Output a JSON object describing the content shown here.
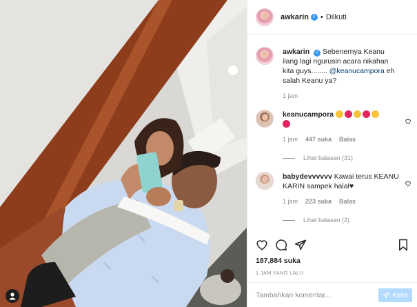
{
  "header": {
    "username": "awkarin",
    "separator": "•",
    "follow_status": "Diikuti"
  },
  "caption": {
    "username": "awkarin",
    "text_before_mention": "Sebenernya Keanu ilang lagi ngurusin acara nikahan kita guys........",
    "mention": "@keanucampora",
    "text_after_mention": "eh salah Keanu ya?",
    "time": "1 jam"
  },
  "comments": [
    {
      "username": "keanucampora",
      "emojis": [
        "grinning-emoji",
        "heart-emoji",
        "grinning-emoji",
        "heart-emoji",
        "grinning-emoji",
        "heart-emoji"
      ],
      "time": "1 jam",
      "likes": "447 suka",
      "reply_label": "Balas",
      "view_replies": "Lihat balasan (31)"
    },
    {
      "username": "babydevvvvvv",
      "text": "Kawai terus KEANU KARIN sampek halal",
      "heart_glyph": "♥",
      "time": "1 jam",
      "likes": "223 suka",
      "reply_label": "Balas",
      "view_replies": "Lihat balasan (2)"
    }
  ],
  "actions": {
    "icons": [
      "heart-icon",
      "comment-icon",
      "share-icon",
      "bookmark-icon"
    ]
  },
  "likes_count": "187,884 suka",
  "timestamp": "1 JAM YANG LALU",
  "comment_box": {
    "placeholder": "Tambahkan komentar...",
    "send_label": "Kirim"
  },
  "colors": {
    "link_blue": "#00376b",
    "verified_blue": "#3897f0",
    "muted_text": "#8e8e8e",
    "send_button": "#b3dbff"
  }
}
